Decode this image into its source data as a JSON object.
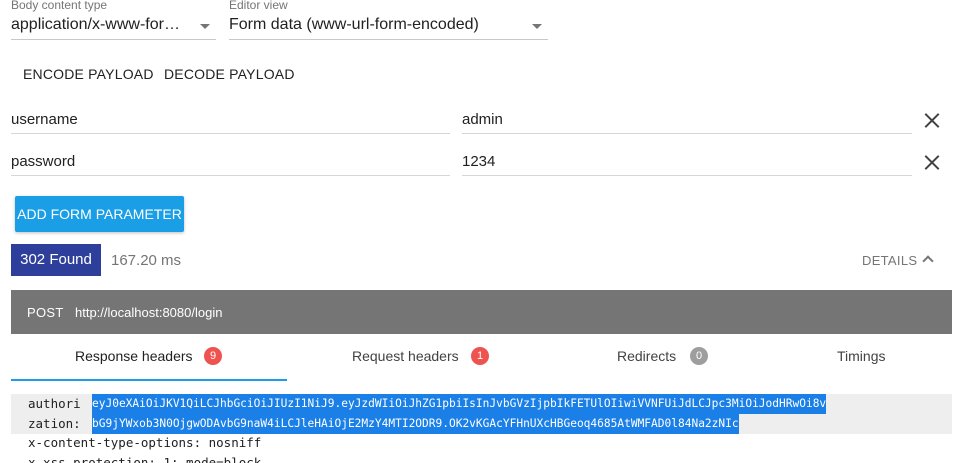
{
  "body_content_type": {
    "label": "Body content type",
    "value": "application/x-www-for…"
  },
  "editor_view": {
    "label": "Editor view",
    "value": "Form data (www-url-form-encoded)"
  },
  "payload_actions": {
    "encode": "ENCODE PAYLOAD",
    "decode": "DECODE PAYLOAD"
  },
  "form_params": [
    {
      "name": "username",
      "value": "admin"
    },
    {
      "name": "password",
      "value": "1234"
    }
  ],
  "add_param_label": "ADD FORM PARAMETER",
  "response": {
    "status": "302 Found",
    "time": "167.20 ms",
    "details_label": "DETAILS",
    "method": "POST",
    "url": "http://localhost:8080/login"
  },
  "tabs": [
    {
      "label": "Response headers",
      "count": "9",
      "badge_color": "#ef5350"
    },
    {
      "label": "Request headers",
      "count": "1",
      "badge_color": "#ef5350"
    },
    {
      "label": "Redirects",
      "count": "0",
      "badge_color": "#9e9e9e"
    },
    {
      "label": "Timings",
      "count": ""
    }
  ],
  "headers": {
    "auth_name_part1": "authori",
    "auth_name_part2": "zation:",
    "auth_value_line1": "eyJ0eXAiOiJKV1QiLCJhbGciOiJIUzI1NiJ9.eyJzdWIiOiJhZG1pbiIsInJvbGVzIjpbIkFETUlOIiwiVVNFUiJdLCJpc3MiOiJodHRwOi8v",
    "auth_value_line2": "bG9jYWxob3N0OjgwODAvbG9naW4iLCJleHAiOjE2MzY4MTI2ODR9.OK2vKGAcYFHnUXcHBGeoq4685AtWMFAD0l84Na2zNIc",
    "row2": "x-content-type-options: nosniff",
    "row3": "x-xss-protection: 1; mode=block"
  },
  "colors": {
    "accent_blue": "#1a9ee6",
    "status_indigo": "#2e3f9b",
    "url_bar_gray": "#757575"
  }
}
